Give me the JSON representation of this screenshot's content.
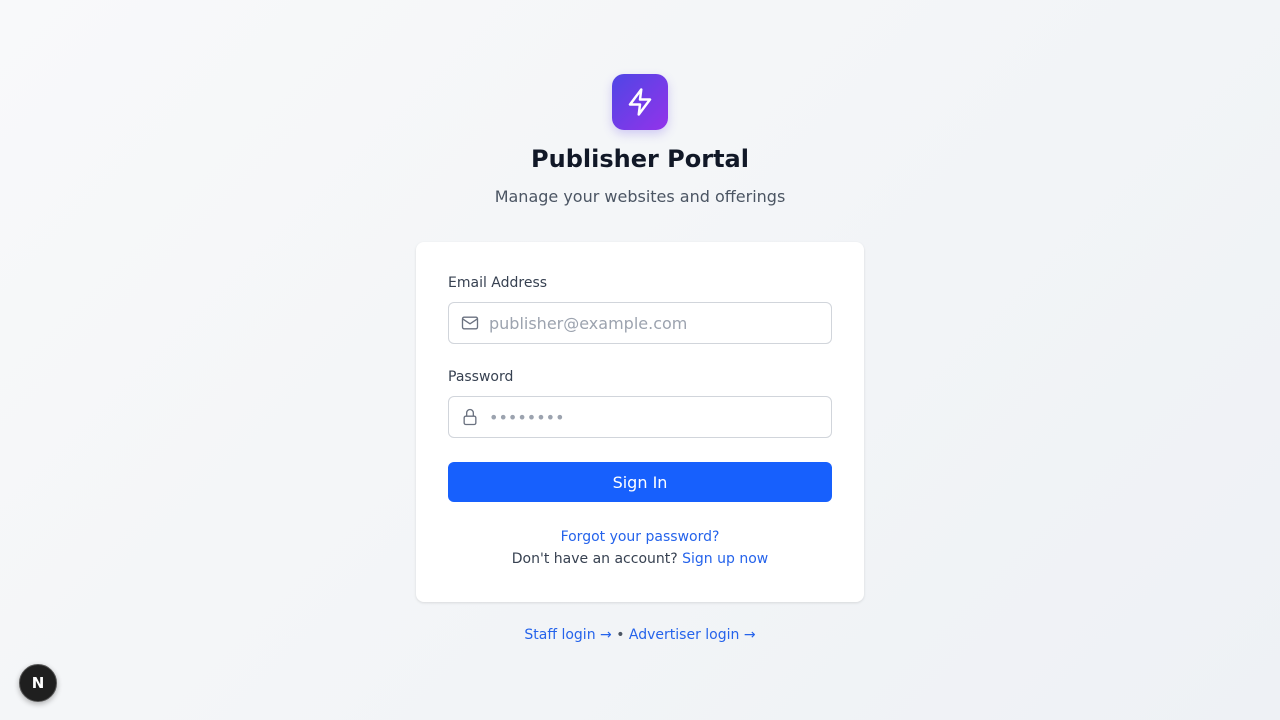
{
  "brand": {
    "logo_icon": "lightning-bolt-icon",
    "title": "Publisher Portal",
    "subtitle": "Manage your websites and offerings",
    "gradient_from": "#4f46e5",
    "gradient_to": "#9333ea"
  },
  "form": {
    "email_label": "Email Address",
    "email_placeholder": "publisher@example.com",
    "email_value": "",
    "email_icon": "mail-icon",
    "password_label": "Password",
    "password_placeholder": "••••••••",
    "password_value": "",
    "password_icon": "lock-icon",
    "submit_label": "Sign In",
    "submit_color": "#1760fd"
  },
  "links": {
    "forgot": "Forgot your password?",
    "signup_prompt": "Don't have an account?",
    "signup": "Sign up now",
    "staff": "Staff login →",
    "separator": "•",
    "advertiser": "Advertiser login →",
    "link_color": "#2563eb"
  },
  "dev_badge": {
    "label": "N"
  }
}
